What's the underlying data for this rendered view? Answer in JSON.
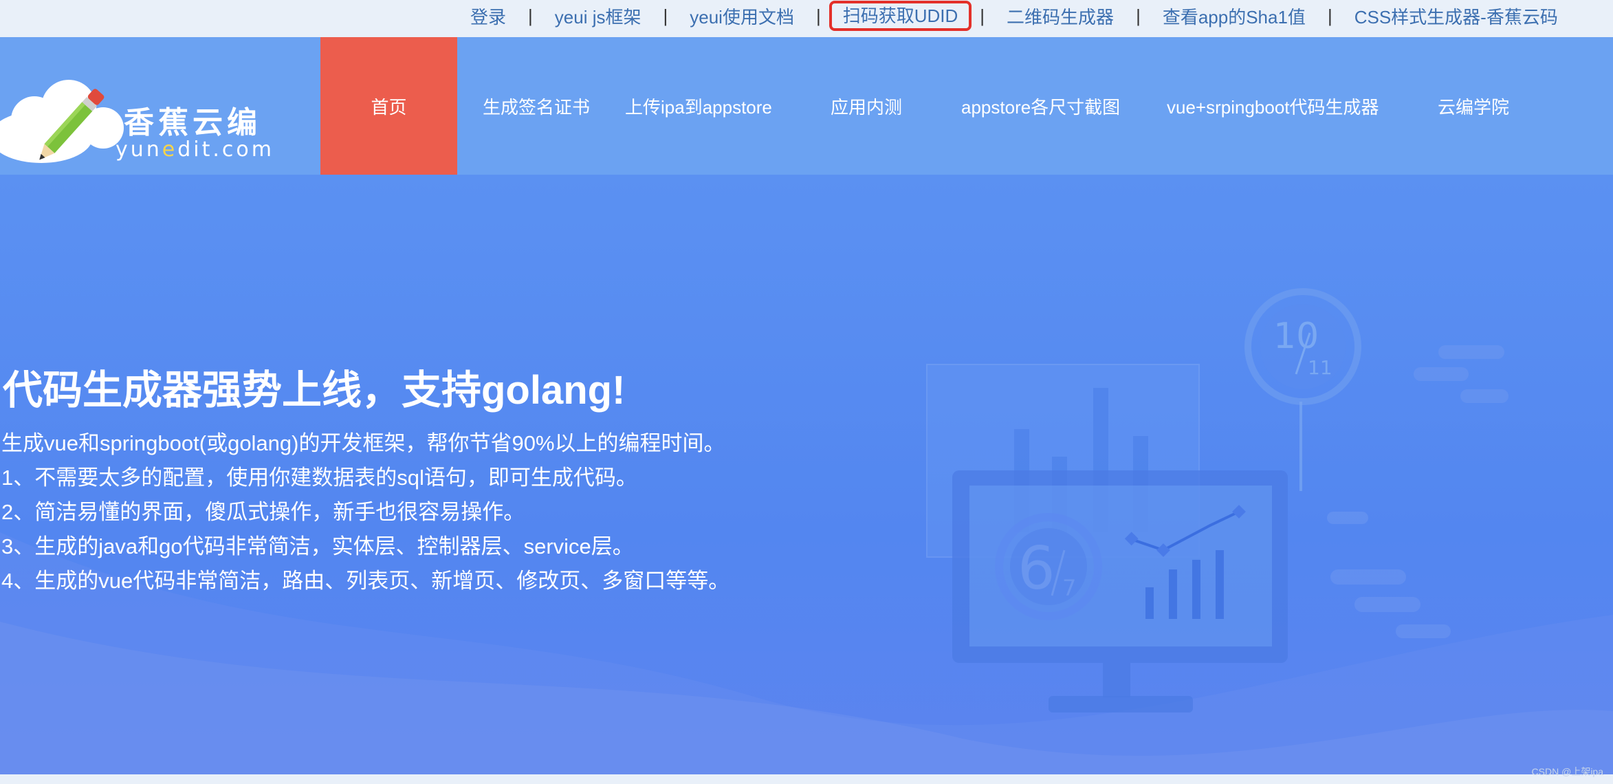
{
  "toplinks": {
    "login": "登录",
    "sep": "|",
    "yeui_js": "yeui js框架",
    "yeui_docs": "yeui使用文档",
    "udid": "扫码获取UDID",
    "qrcode": "二维码生成器",
    "sha1": "查看app的Sha1值",
    "css": "CSS样式生成器-香蕉云码"
  },
  "logo": {
    "cn": "香蕉云编",
    "en_pre": "yun",
    "en_e": "e",
    "en_post": "dit.com"
  },
  "nav": {
    "items": [
      "首页",
      "生成签名证书",
      "上传ipa到appstore",
      "应用内测",
      "appstore各尺寸截图",
      "vue+srpingboot代码生成器",
      "云编学院"
    ]
  },
  "hero": {
    "title": "代码生成器强势上线，支持golang!",
    "lines": [
      "生成vue和springboot(或golang)的开发框架，帮你节省90%以上的编程时间。",
      "1、不需要太多的配置，使用你建数据表的sql语句，即可生成代码。",
      "2、简洁易懂的界面，傻瓜式操作，新手也很容易操作。",
      "3、生成的java和go代码非常简洁，实体层、控制器层、service层。",
      "4、生成的vue代码非常简洁，路由、列表页、新增页、修改页、多窗口等等。"
    ]
  },
  "illustration": {
    "badge_top_num": "10",
    "badge_top_den": "11",
    "badge_bottom_num": "6",
    "badge_bottom_den": "7"
  },
  "watermark": "CSDN @上架ipa",
  "colors": {
    "nav_active": "#ec5d4d",
    "header_bg": "#6ba2f2",
    "hero_bg": "#5386f0",
    "link": "#3c6fb0",
    "highlight_border": "#e3302a"
  }
}
